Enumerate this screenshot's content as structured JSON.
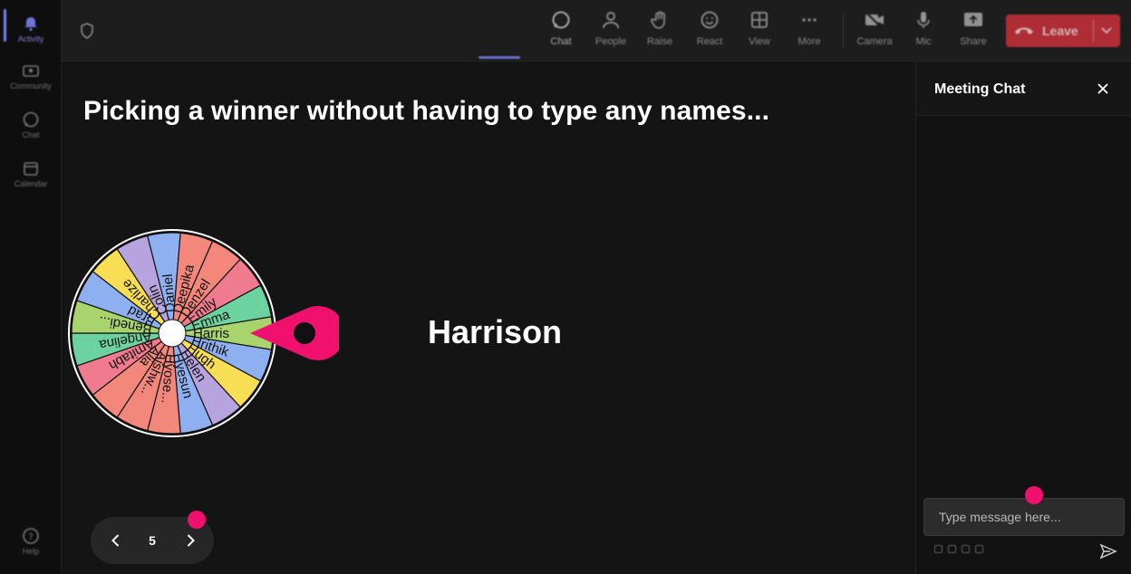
{
  "rail": {
    "items": [
      {
        "label": "Activity",
        "icon": "bell-icon"
      },
      {
        "label": "Community",
        "icon": "community-icon"
      },
      {
        "label": "Chat",
        "icon": "chat-icon"
      },
      {
        "label": "Calendar",
        "icon": "calendar-icon"
      }
    ],
    "help_label": "Help"
  },
  "toolbar": {
    "chat_label": "Chat",
    "people_label": "People",
    "raise_label": "Raise",
    "react_label": "React",
    "view_label": "View",
    "more_label": "More",
    "camera_label": "Camera",
    "mic_label": "Mic",
    "share_label": "Share",
    "leave_label": "Leave"
  },
  "stage": {
    "headline": "Picking a winner without having to type any names...",
    "winner": "Harrison",
    "wheel_names": [
      "Harris",
      "Hrithik",
      "Hugh",
      "Helen",
      "Hyesun",
      "Hyose...",
      "Aishw...",
      "Alia",
      "Amitabh",
      "Angelina",
      "Benedi...",
      "Brad",
      "Charlize",
      "Colin",
      "Daniel",
      "Deepika",
      "Denzel",
      "Emily",
      "Emma"
    ],
    "wheel_colors": [
      "#a9d36c",
      "#8fb0f0",
      "#f7de52",
      "#b7a3de",
      "#8fb0f0",
      "#f4877c",
      "#f4877c",
      "#f4877c",
      "#f07a8e",
      "#6cd3a0",
      "#a9d36c",
      "#8fb0f0",
      "#f7de52",
      "#b7a3de",
      "#8fb0f0",
      "#f4877c",
      "#f4877c",
      "#f07a8e",
      "#6cd3a0"
    ],
    "page_number": "5"
  },
  "chat": {
    "title": "Meeting Chat",
    "input_placeholder": "Type message here..."
  },
  "colors": {
    "accent": "#7b7ff0",
    "leave": "#c9303a",
    "pointer": "#f0116e"
  }
}
